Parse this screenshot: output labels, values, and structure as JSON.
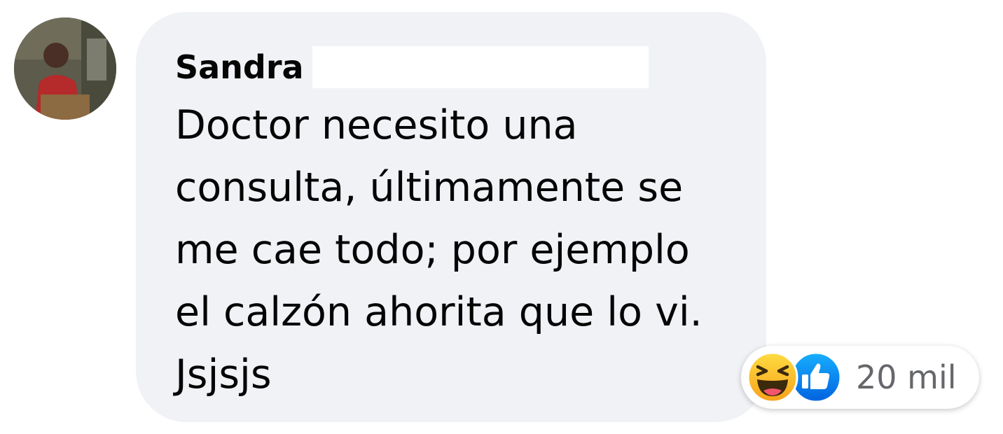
{
  "comment": {
    "author_name": "Sandra",
    "text_lines": [
      "Doctor necesito una",
      "consulta, últimamente se",
      "me cae todo; por ejemplo",
      "el calzón ahorita que lo vi.",
      "Jsjsjs"
    ],
    "reactions": {
      "icons": [
        "haha-reaction-icon",
        "like-reaction-icon"
      ],
      "count": "20 mil"
    }
  },
  "colors": {
    "bubble_background": "#f0f2f5",
    "text": "#050505",
    "secondary_text": "#65676b",
    "like_blue": "#1877f2",
    "haha_yellow": "#f7b125"
  }
}
